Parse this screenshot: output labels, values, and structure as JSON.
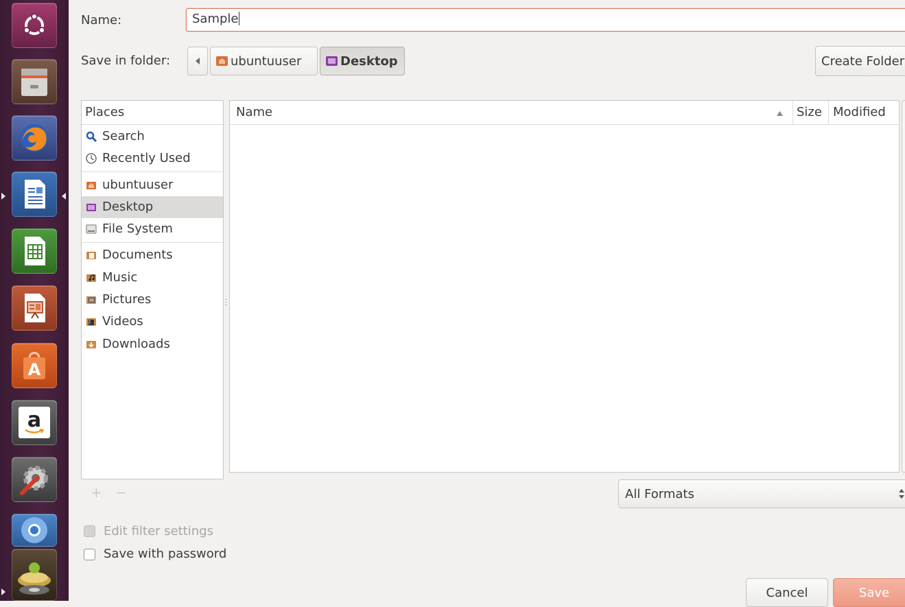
{
  "launcher": {
    "items": [
      {
        "icon": "ubuntu-dash-icon"
      },
      {
        "icon": "file-manager-icon"
      },
      {
        "icon": "firefox-icon"
      },
      {
        "icon": "libreoffice-writer-icon"
      },
      {
        "icon": "libreoffice-calc-icon"
      },
      {
        "icon": "libreoffice-impress-icon"
      },
      {
        "icon": "ubuntu-software-center-icon"
      },
      {
        "icon": "amazon-icon"
      },
      {
        "icon": "system-settings-icon"
      },
      {
        "icon": "chromium-icon"
      },
      {
        "icon": "disk-installer-icon"
      }
    ],
    "amazon_letter": "a"
  },
  "dialog": {
    "name_label": "Name:",
    "name_value": "Sample",
    "save_in_label": "Save in folder:",
    "path": [
      {
        "label": "ubuntuuser"
      },
      {
        "label": "Desktop"
      }
    ],
    "create_folder_label": "Create Folder",
    "places": {
      "header": "Places",
      "items": [
        {
          "label": "Search",
          "icon": "search-icon"
        },
        {
          "label": "Recently Used",
          "icon": "recent-icon"
        },
        {
          "label": "ubuntuuser",
          "icon": "home-folder-icon"
        },
        {
          "label": "Desktop",
          "icon": "desktop-folder-icon",
          "selected": true
        },
        {
          "label": "File System",
          "icon": "drive-icon"
        },
        {
          "label": "Documents",
          "icon": "documents-folder-icon"
        },
        {
          "label": "Music",
          "icon": "music-folder-icon"
        },
        {
          "label": "Pictures",
          "icon": "pictures-folder-icon"
        },
        {
          "label": "Videos",
          "icon": "videos-folder-icon"
        },
        {
          "label": "Downloads",
          "icon": "downloads-folder-icon"
        }
      ]
    },
    "files": {
      "col_name": "Name",
      "col_size": "Size",
      "col_modified": "Modified",
      "rows": []
    },
    "add_bookmark": "+",
    "remove_bookmark": "−",
    "format_select": "All Formats",
    "edit_filter_label": "Edit filter settings",
    "save_password_label": "Save with password",
    "cancel_label": "Cancel",
    "save_label": "Save"
  },
  "colors": {
    "accent": "#e0745a",
    "launcher_bg": "#4a2340",
    "selection": "#dcdbd9",
    "save_button": "#f1a38f"
  }
}
